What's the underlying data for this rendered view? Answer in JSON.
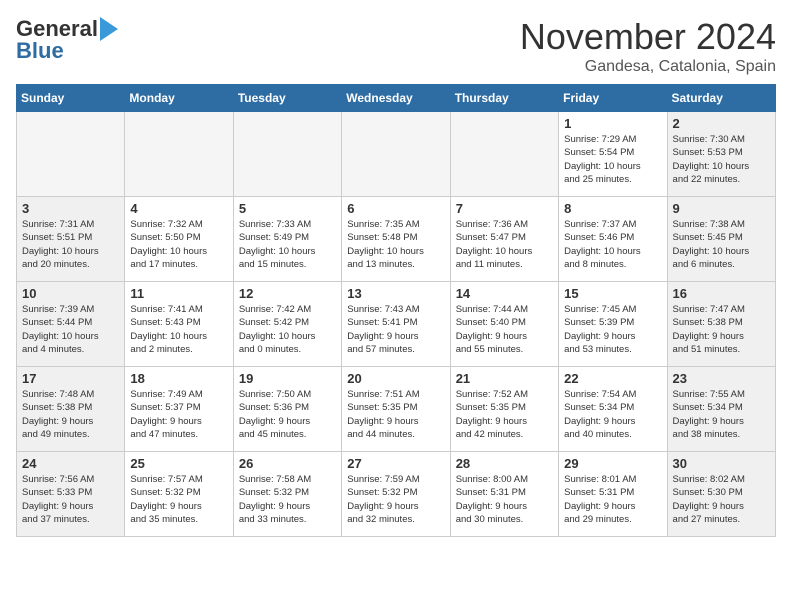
{
  "header": {
    "logo_line1": "General",
    "logo_line2": "Blue",
    "month": "November 2024",
    "location": "Gandesa, Catalonia, Spain"
  },
  "weekdays": [
    "Sunday",
    "Monday",
    "Tuesday",
    "Wednesday",
    "Thursday",
    "Friday",
    "Saturday"
  ],
  "weeks": [
    [
      {
        "day": "",
        "info": "",
        "empty": true
      },
      {
        "day": "",
        "info": "",
        "empty": true
      },
      {
        "day": "",
        "info": "",
        "empty": true
      },
      {
        "day": "",
        "info": "",
        "empty": true
      },
      {
        "day": "",
        "info": "",
        "empty": true
      },
      {
        "day": "1",
        "info": "Sunrise: 7:29 AM\nSunset: 5:54 PM\nDaylight: 10 hours\nand 25 minutes."
      },
      {
        "day": "2",
        "info": "Sunrise: 7:30 AM\nSunset: 5:53 PM\nDaylight: 10 hours\nand 22 minutes."
      }
    ],
    [
      {
        "day": "3",
        "info": "Sunrise: 7:31 AM\nSunset: 5:51 PM\nDaylight: 10 hours\nand 20 minutes."
      },
      {
        "day": "4",
        "info": "Sunrise: 7:32 AM\nSunset: 5:50 PM\nDaylight: 10 hours\nand 17 minutes."
      },
      {
        "day": "5",
        "info": "Sunrise: 7:33 AM\nSunset: 5:49 PM\nDaylight: 10 hours\nand 15 minutes."
      },
      {
        "day": "6",
        "info": "Sunrise: 7:35 AM\nSunset: 5:48 PM\nDaylight: 10 hours\nand 13 minutes."
      },
      {
        "day": "7",
        "info": "Sunrise: 7:36 AM\nSunset: 5:47 PM\nDaylight: 10 hours\nand 11 minutes."
      },
      {
        "day": "8",
        "info": "Sunrise: 7:37 AM\nSunset: 5:46 PM\nDaylight: 10 hours\nand 8 minutes."
      },
      {
        "day": "9",
        "info": "Sunrise: 7:38 AM\nSunset: 5:45 PM\nDaylight: 10 hours\nand 6 minutes."
      }
    ],
    [
      {
        "day": "10",
        "info": "Sunrise: 7:39 AM\nSunset: 5:44 PM\nDaylight: 10 hours\nand 4 minutes."
      },
      {
        "day": "11",
        "info": "Sunrise: 7:41 AM\nSunset: 5:43 PM\nDaylight: 10 hours\nand 2 minutes."
      },
      {
        "day": "12",
        "info": "Sunrise: 7:42 AM\nSunset: 5:42 PM\nDaylight: 10 hours\nand 0 minutes."
      },
      {
        "day": "13",
        "info": "Sunrise: 7:43 AM\nSunset: 5:41 PM\nDaylight: 9 hours\nand 57 minutes."
      },
      {
        "day": "14",
        "info": "Sunrise: 7:44 AM\nSunset: 5:40 PM\nDaylight: 9 hours\nand 55 minutes."
      },
      {
        "day": "15",
        "info": "Sunrise: 7:45 AM\nSunset: 5:39 PM\nDaylight: 9 hours\nand 53 minutes."
      },
      {
        "day": "16",
        "info": "Sunrise: 7:47 AM\nSunset: 5:38 PM\nDaylight: 9 hours\nand 51 minutes."
      }
    ],
    [
      {
        "day": "17",
        "info": "Sunrise: 7:48 AM\nSunset: 5:38 PM\nDaylight: 9 hours\nand 49 minutes."
      },
      {
        "day": "18",
        "info": "Sunrise: 7:49 AM\nSunset: 5:37 PM\nDaylight: 9 hours\nand 47 minutes."
      },
      {
        "day": "19",
        "info": "Sunrise: 7:50 AM\nSunset: 5:36 PM\nDaylight: 9 hours\nand 45 minutes."
      },
      {
        "day": "20",
        "info": "Sunrise: 7:51 AM\nSunset: 5:35 PM\nDaylight: 9 hours\nand 44 minutes."
      },
      {
        "day": "21",
        "info": "Sunrise: 7:52 AM\nSunset: 5:35 PM\nDaylight: 9 hours\nand 42 minutes."
      },
      {
        "day": "22",
        "info": "Sunrise: 7:54 AM\nSunset: 5:34 PM\nDaylight: 9 hours\nand 40 minutes."
      },
      {
        "day": "23",
        "info": "Sunrise: 7:55 AM\nSunset: 5:34 PM\nDaylight: 9 hours\nand 38 minutes."
      }
    ],
    [
      {
        "day": "24",
        "info": "Sunrise: 7:56 AM\nSunset: 5:33 PM\nDaylight: 9 hours\nand 37 minutes."
      },
      {
        "day": "25",
        "info": "Sunrise: 7:57 AM\nSunset: 5:32 PM\nDaylight: 9 hours\nand 35 minutes."
      },
      {
        "day": "26",
        "info": "Sunrise: 7:58 AM\nSunset: 5:32 PM\nDaylight: 9 hours\nand 33 minutes."
      },
      {
        "day": "27",
        "info": "Sunrise: 7:59 AM\nSunset: 5:32 PM\nDaylight: 9 hours\nand 32 minutes."
      },
      {
        "day": "28",
        "info": "Sunrise: 8:00 AM\nSunset: 5:31 PM\nDaylight: 9 hours\nand 30 minutes."
      },
      {
        "day": "29",
        "info": "Sunrise: 8:01 AM\nSunset: 5:31 PM\nDaylight: 9 hours\nand 29 minutes."
      },
      {
        "day": "30",
        "info": "Sunrise: 8:02 AM\nSunset: 5:30 PM\nDaylight: 9 hours\nand 27 minutes."
      }
    ]
  ]
}
